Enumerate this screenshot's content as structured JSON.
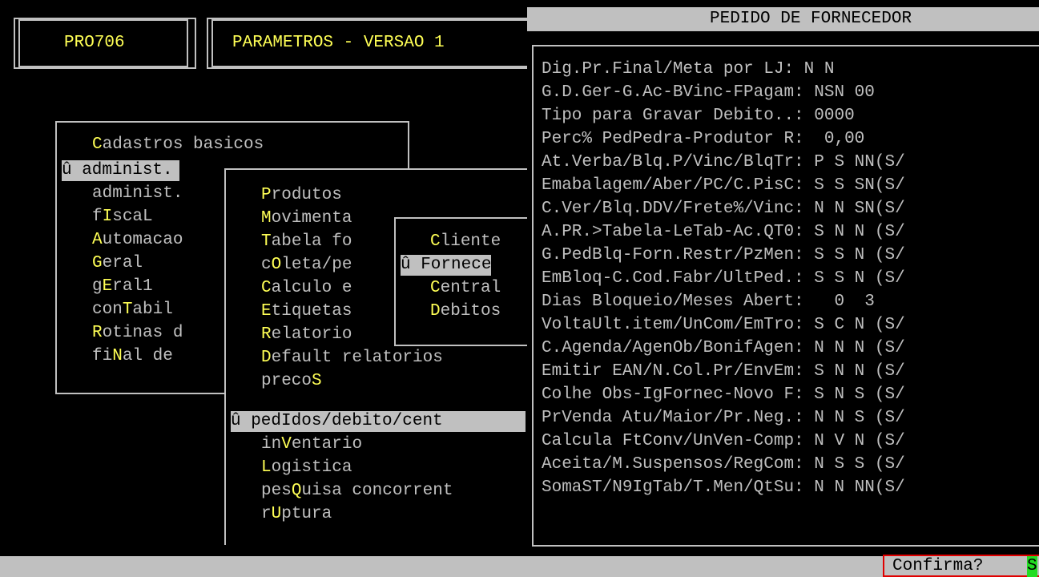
{
  "header": {
    "program_code": "PRO706",
    "module_title": "PARAMETROS - VERSAO 1",
    "window_title": "PEDIDO DE FORNECEDOR"
  },
  "main_menu": {
    "items": [
      {
        "pre": "",
        "key": "C",
        "post": "adastros basicos"
      },
      {
        "selected": "û administ."
      },
      {
        "pre": "administ.",
        "key": "",
        "post": ""
      },
      {
        "pre": "f",
        "key": "I",
        "post": "scaL"
      },
      {
        "pre": "",
        "key": "A",
        "post": "utomacao"
      },
      {
        "pre": "",
        "key": "G",
        "post": "eral"
      },
      {
        "pre": "g",
        "key": "E",
        "post": "ral1"
      },
      {
        "pre": "con",
        "key": "T",
        "post": "abil"
      },
      {
        "pre": "",
        "key": "R",
        "post": "otinas d"
      },
      {
        "pre": "fi",
        "key": "N",
        "post": "al de"
      }
    ]
  },
  "sub_menu": {
    "items": [
      {
        "pre": "",
        "key": "P",
        "post": "rodutos"
      },
      {
        "pre": "",
        "key": "M",
        "post": "ovimenta"
      },
      {
        "pre": "",
        "key": "T",
        "post": "abela fo"
      },
      {
        "pre": "c",
        "key": "O",
        "post": "leta/pe"
      },
      {
        "pre": "",
        "key": "C",
        "post": "alculo e"
      },
      {
        "pre": "",
        "key": "E",
        "post": "tiquetas"
      },
      {
        "pre": "",
        "key": "R",
        "post": "elatorio"
      },
      {
        "pre": "",
        "key": "D",
        "post": "efault relatorios"
      },
      {
        "pre": "preco",
        "key": "S",
        "post": ""
      },
      {
        "selected": "û pedIdos/debito/cent"
      },
      {
        "pre": "in",
        "key": "V",
        "post": "entario"
      },
      {
        "pre": "",
        "key": "L",
        "post": "ogistica"
      },
      {
        "pre": "pes",
        "key": "Q",
        "post": "uisa concorrent"
      },
      {
        "pre": "r",
        "key": "U",
        "post": "ptura"
      }
    ]
  },
  "third_menu": {
    "items": [
      {
        "pre": "",
        "key": "C",
        "post": "liente"
      },
      {
        "selected": "û Fornece"
      },
      {
        "pre": "",
        "key": "C",
        "post": "entral"
      },
      {
        "pre": "",
        "key": "D",
        "post": "ebitos"
      }
    ]
  },
  "params": [
    {
      "label": "Dig.Pr.Final/Meta por LJ:",
      "value": " N N"
    },
    {
      "label": "G.D.Ger-G.Ac-BVinc-FPagam:",
      "value": " NSN 00"
    },
    {
      "label": "Tipo para Gravar Debito..:",
      "value": " 0000"
    },
    {
      "label": "Perc% PedPedra-Produtor R:",
      "value": "  0,00"
    },
    {
      "label": "At.Verba/Blq.P/Vinc/BlqTr:",
      "value": " P S NN(S/"
    },
    {
      "label": "Emabalagem/Aber/PC/C.PisC:",
      "value": " S S SN(S/"
    },
    {
      "label": "C.Ver/Blq.DDV/Frete%/Vinc:",
      "value": " N N SN(S/"
    },
    {
      "label": "A.PR.>Tabela-LeTab-Ac.QT0:",
      "value": " S N N (S/"
    },
    {
      "label": "G.PedBlq-Forn.Restr/PzMen:",
      "value": " S S N (S/"
    },
    {
      "label": "EmBloq-C.Cod.Fabr/UltPed.:",
      "value": " S S N (S/"
    },
    {
      "label": "Dias Bloqueio/Meses Abert:",
      "value": "   0  3"
    },
    {
      "label": "VoltaUlt.item/UnCom/EmTro:",
      "value": " S C N (S/"
    },
    {
      "label": "C.Agenda/AgenOb/BonifAgen:",
      "value": " N N N (S/"
    },
    {
      "label": "Emitir EAN/N.Col.Pr/EnvEm:",
      "value": " S N N (S/"
    },
    {
      "label": "Colhe Obs-IgFornec-Novo F:",
      "value": " S N S (S/"
    },
    {
      "label": "PrVenda Atu/Maior/Pr.Neg.:",
      "value": " N N S (S/"
    },
    {
      "label": "Calcula FtConv/UnVen-Comp:",
      "value": " N V N (S/"
    },
    {
      "label": "Aceita/M.Suspensos/RegCom:",
      "value": " N S S (S/"
    },
    {
      "label": "SomaST/N9IgTab/T.Men/QtSu:",
      "value": " N N NN(S/"
    }
  ],
  "status": {
    "prompt": "Confirma?",
    "answer": "S"
  }
}
